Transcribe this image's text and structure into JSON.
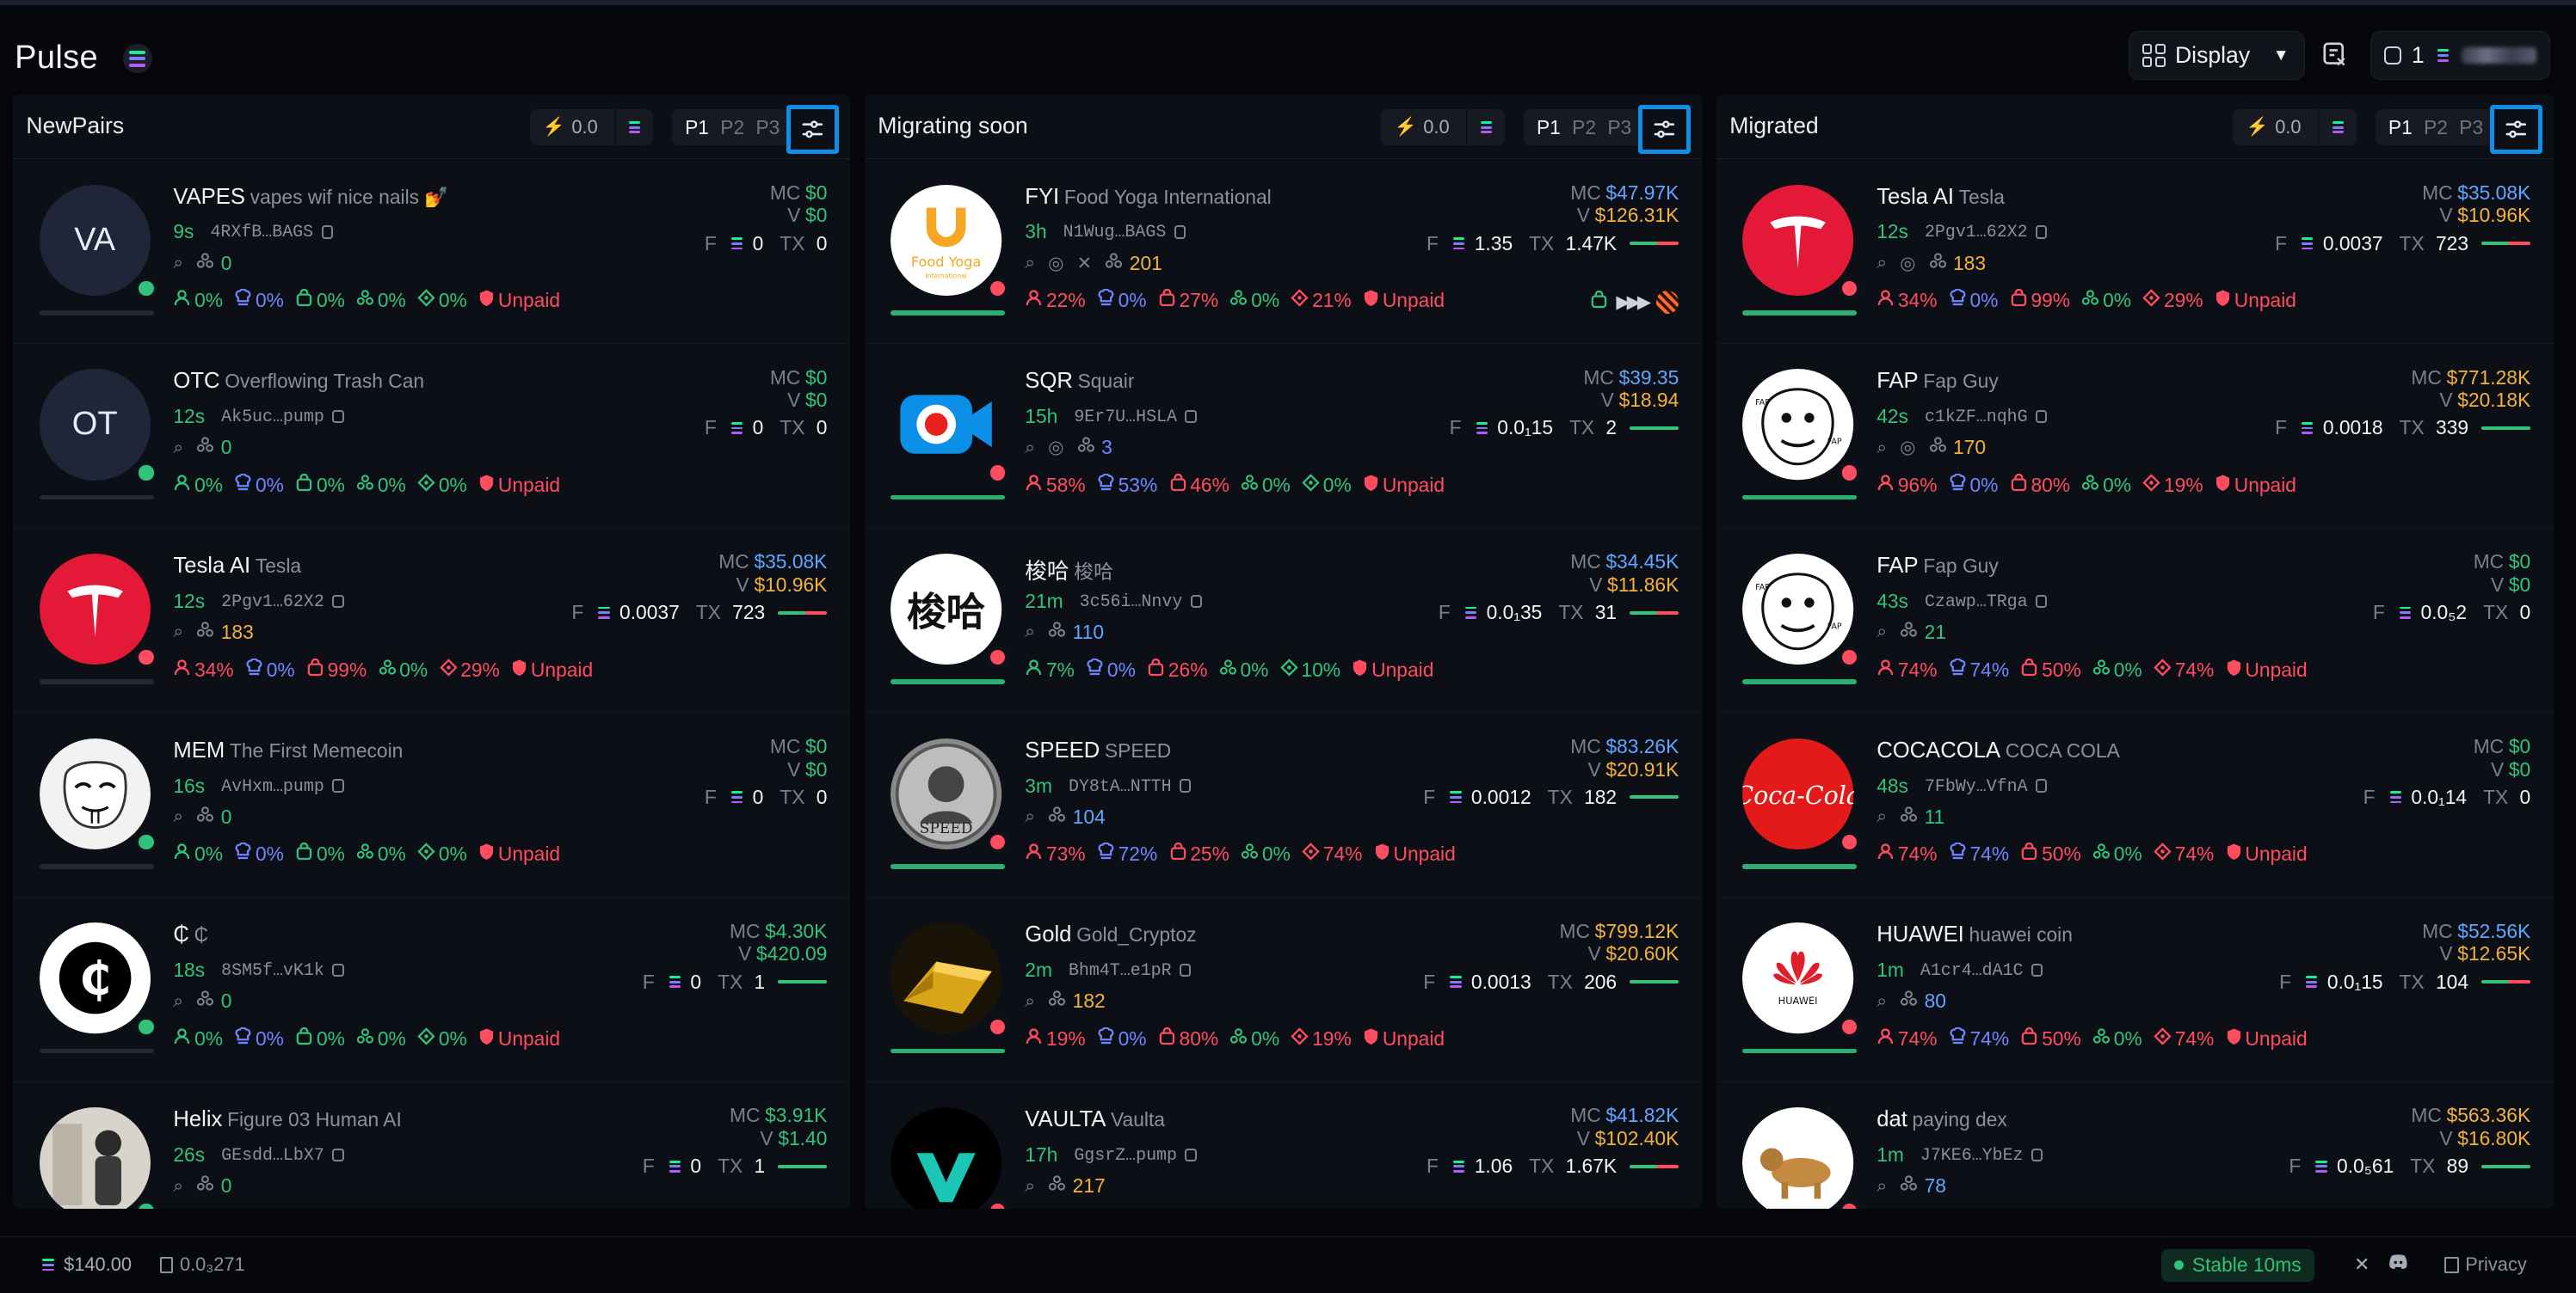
{
  "header": {
    "title": "Pulse",
    "display_label": "Display",
    "wallet_count": "1"
  },
  "columns": [
    {
      "title": "Migrating soon",
      "speed": "0.0",
      "presets": [
        "P1",
        "P2",
        "P3"
      ],
      "rows": [
        {
          "ticker": "FYI",
          "name": "Food Yoga International",
          "age": "3h",
          "addr": "N1Wug…BAGS",
          "holders": "201",
          "holders_color": "#f3b23a",
          "mc": "$47.97K",
          "mc_color": "#5fa7ff",
          "v": "$126.31K",
          "f": "1.35",
          "tx": "1.47K",
          "stats": [
            [
              "22%",
              "r"
            ],
            [
              "0%",
              "b"
            ],
            [
              "27%",
              "r"
            ],
            [
              "0%",
              "g"
            ],
            [
              "21%",
              "r"
            ]
          ],
          "paid": "Unpaid",
          "avatar": "fyi",
          "bar": "#ff4c5f",
          "progress": 1
        },
        {
          "ticker": "SQR",
          "name": "Squair",
          "age": "15h",
          "addr": "9Er7U…HSLA",
          "holders": "3",
          "holders_color": "#6f86ff",
          "mc": "$39.35",
          "mc_color": "#5fa7ff",
          "v": "$18.94",
          "f": "0.0₁15",
          "tx": "2",
          "stats": [
            [
              "58%",
              "r"
            ],
            [
              "53%",
              "b"
            ],
            [
              "46%",
              "r"
            ],
            [
              "0%",
              "g"
            ],
            [
              "0%",
              "g"
            ]
          ],
          "paid": "Unpaid",
          "avatar": "sqr",
          "bar": "#31c27c",
          "progress": 1
        },
        {
          "ticker": "梭哈",
          "name": "梭哈",
          "age": "21m",
          "addr": "3c56i…Nnvy",
          "holders": "110",
          "holders_color": "#5fa7ff",
          "mc": "$34.45K",
          "mc_color": "#5fa7ff",
          "v": "$11.86K",
          "f": "0.0₁35",
          "tx": "31",
          "stats": [
            [
              "7%",
              "g"
            ],
            [
              "0%",
              "b"
            ],
            [
              "26%",
              "r"
            ],
            [
              "0%",
              "g"
            ],
            [
              "10%",
              "g"
            ]
          ],
          "paid": "Unpaid",
          "avatar": "suoha",
          "bar": "#ff4c5f",
          "progress": 1
        },
        {
          "ticker": "SPEED",
          "name": "SPEED",
          "age": "3m",
          "addr": "DY8tA…NTTH",
          "holders": "104",
          "holders_color": "#5fa7ff",
          "mc": "$83.26K",
          "mc_color": "#5fa7ff",
          "v": "$20.91K",
          "f": "0.0012",
          "tx": "182",
          "stats": [
            [
              "73%",
              "r"
            ],
            [
              "72%",
              "b"
            ],
            [
              "25%",
              "r"
            ],
            [
              "0%",
              "g"
            ],
            [
              "74%",
              "r"
            ]
          ],
          "paid": "Unpaid",
          "avatar": "speed",
          "bar": "#31c27c",
          "progress": 1
        },
        {
          "ticker": "Gold",
          "name": "Gold_Cryptoz",
          "age": "2m",
          "addr": "Bhm4T…e1pR",
          "holders": "182",
          "holders_color": "#f3b23a",
          "mc": "$799.12K",
          "mc_color": "#f3b23a",
          "v": "$20.60K",
          "f": "0.0013",
          "tx": "206",
          "stats": [
            [
              "19%",
              "r"
            ],
            [
              "0%",
              "b"
            ],
            [
              "80%",
              "r"
            ],
            [
              "0%",
              "g"
            ],
            [
              "19%",
              "r"
            ]
          ],
          "paid": "Unpaid",
          "avatar": "gold",
          "bar": "#31c27c",
          "progress": 1
        },
        {
          "ticker": "VAULTA",
          "name": "Vaulta",
          "age": "17h",
          "addr": "GgsrZ…pump",
          "holders": "217",
          "holders_color": "#f3b23a",
          "mc": "$41.82K",
          "mc_color": "#5fa7ff",
          "v": "$102.40K",
          "f": "1.06",
          "tx": "1.67K",
          "stats": [],
          "paid": "",
          "avatar": "vaulta",
          "bar": "#ff4c5f",
          "progress": 1
        }
      ]
    },
    {
      "title": "NewPairs",
      "speed": "0.0",
      "presets": [
        "P1",
        "P2",
        "P3"
      ],
      "rows": [
        {
          "ticker": "VAPES",
          "name": "vapes wif nice nails 💅",
          "age": "9s",
          "addr": "4RXfB…BAGS",
          "holders": "0",
          "holders_color": "#31c27c",
          "mc": "$0",
          "mc_color": "#31c27c",
          "v": "$0",
          "f": "0",
          "tx": "0",
          "stats": [
            [
              "0%",
              "g"
            ],
            [
              "0%",
              "b"
            ],
            [
              "0%",
              "g"
            ],
            [
              "0%",
              "g"
            ],
            [
              "0%",
              "g"
            ]
          ],
          "paid": "Unpaid",
          "avatar": "VA",
          "bar": "",
          "progress": 0
        },
        {
          "ticker": "OTC",
          "name": "Overflowing Trash Can",
          "age": "12s",
          "addr": "Ak5uc…pump",
          "holders": "0",
          "holders_color": "#31c27c",
          "mc": "$0",
          "mc_color": "#31c27c",
          "v": "$0",
          "f": "0",
          "tx": "0",
          "stats": [
            [
              "0%",
              "g"
            ],
            [
              "0%",
              "b"
            ],
            [
              "0%",
              "g"
            ],
            [
              "0%",
              "g"
            ],
            [
              "0%",
              "g"
            ]
          ],
          "paid": "Unpaid",
          "avatar": "OT",
          "bar": "",
          "progress": 0
        },
        {
          "ticker": "Tesla AI",
          "name": "Tesla",
          "age": "12s",
          "addr": "2Pgv1…62X2",
          "holders": "183",
          "holders_color": "#f3b23a",
          "mc": "$35.08K",
          "mc_color": "#5fa7ff",
          "v": "$10.96K",
          "f": "0.0037",
          "tx": "723",
          "stats": [
            [
              "34%",
              "r"
            ],
            [
              "0%",
              "b"
            ],
            [
              "99%",
              "r"
            ],
            [
              "0%",
              "g"
            ],
            [
              "29%",
              "r"
            ]
          ],
          "paid": "Unpaid",
          "avatar": "tesla",
          "bar": "#ff4c5f",
          "progress": 0
        },
        {
          "ticker": "MEM",
          "name": "The First Memecoin",
          "age": "16s",
          "addr": "AvHxm…pump",
          "holders": "0",
          "holders_color": "#31c27c",
          "mc": "$0",
          "mc_color": "#31c27c",
          "v": "$0",
          "f": "0",
          "tx": "0",
          "stats": [
            [
              "0%",
              "g"
            ],
            [
              "0%",
              "b"
            ],
            [
              "0%",
              "g"
            ],
            [
              "0%",
              "g"
            ],
            [
              "0%",
              "g"
            ]
          ],
          "paid": "Unpaid",
          "avatar": "mask",
          "bar": "",
          "progress": 0
        },
        {
          "ticker": "₵",
          "name": "₵",
          "age": "18s",
          "addr": "8SM5f…vK1k",
          "holders": "0",
          "holders_color": "#31c27c",
          "mc": "$4.30K",
          "mc_color": "#31c27c",
          "v": "$420.09",
          "f": "0",
          "tx": "1",
          "stats": [
            [
              "0%",
              "g"
            ],
            [
              "0%",
              "b"
            ],
            [
              "0%",
              "g"
            ],
            [
              "0%",
              "g"
            ],
            [
              "0%",
              "g"
            ]
          ],
          "paid": "Unpaid",
          "avatar": "cedi",
          "bar": "#31c27c",
          "progress": 0
        },
        {
          "ticker": "Helix",
          "name": "Figure 03 Human AI",
          "age": "26s",
          "addr": "GEsdd…LbX7",
          "holders": "0",
          "holders_color": "#31c27c",
          "mc": "$3.91K",
          "mc_color": "#31c27c",
          "v": "$1.40",
          "f": "0",
          "tx": "1",
          "stats": [],
          "paid": "",
          "avatar": "helix",
          "bar": "#31c27c",
          "progress": 0
        }
      ]
    },
    {
      "title": "Migrated",
      "speed": "0.0",
      "presets": [
        "P1",
        "P2",
        "P3"
      ],
      "rows": [
        {
          "ticker": "Tesla AI",
          "name": "Tesla",
          "age": "12s",
          "addr": "2Pgv1…62X2",
          "holders": "183",
          "holders_color": "#f3b23a",
          "mc": "$35.08K",
          "mc_color": "#5fa7ff",
          "v": "$10.96K",
          "f": "0.0037",
          "tx": "723",
          "stats": [
            [
              "34%",
              "r"
            ],
            [
              "0%",
              "b"
            ],
            [
              "99%",
              "r"
            ],
            [
              "0%",
              "g"
            ],
            [
              "29%",
              "r"
            ]
          ],
          "paid": "Unpaid",
          "avatar": "tesla",
          "bar": "#ff4c5f",
          "progress": 1
        },
        {
          "ticker": "FAP",
          "name": "Fap Guy",
          "age": "42s",
          "addr": "c1kZF…nqhG",
          "holders": "170",
          "holders_color": "#f3b23a",
          "mc": "$771.28K",
          "mc_color": "#f3b23a",
          "v": "$20.18K",
          "f": "0.0018",
          "tx": "339",
          "stats": [
            [
              "96%",
              "r"
            ],
            [
              "0%",
              "b"
            ],
            [
              "80%",
              "r"
            ],
            [
              "0%",
              "g"
            ],
            [
              "19%",
              "r"
            ]
          ],
          "paid": "Unpaid",
          "avatar": "rage",
          "bar": "#31c27c",
          "progress": 1
        },
        {
          "ticker": "FAP",
          "name": "Fap Guy",
          "age": "43s",
          "addr": "Czawp…TRga",
          "holders": "21",
          "holders_color": "#31c27c",
          "mc": "$0",
          "mc_color": "#31c27c",
          "v": "$0",
          "f": "0.0₅2",
          "tx": "0",
          "stats": [
            [
              "74%",
              "r"
            ],
            [
              "74%",
              "b"
            ],
            [
              "50%",
              "r"
            ],
            [
              "0%",
              "g"
            ],
            [
              "74%",
              "r"
            ]
          ],
          "paid": "Unpaid",
          "avatar": "rage",
          "bar": "",
          "progress": 1
        },
        {
          "ticker": "COCACOLA",
          "name": "COCA COLA",
          "age": "48s",
          "addr": "7FbWy…VfnA",
          "holders": "11",
          "holders_color": "#31c27c",
          "mc": "$0",
          "mc_color": "#31c27c",
          "v": "$0",
          "f": "0.0₁14",
          "tx": "0",
          "stats": [
            [
              "74%",
              "r"
            ],
            [
              "74%",
              "b"
            ],
            [
              "50%",
              "r"
            ],
            [
              "0%",
              "g"
            ],
            [
              "74%",
              "r"
            ]
          ],
          "paid": "Unpaid",
          "avatar": "coke",
          "bar": "",
          "progress": 1
        },
        {
          "ticker": "HUAWEI",
          "name": "huawei coin",
          "age": "1m",
          "addr": "A1cr4…dA1C",
          "holders": "80",
          "holders_color": "#5fa7ff",
          "mc": "$52.56K",
          "mc_color": "#5fa7ff",
          "v": "$12.65K",
          "f": "0.0₁15",
          "tx": "104",
          "stats": [
            [
              "74%",
              "r"
            ],
            [
              "74%",
              "b"
            ],
            [
              "50%",
              "r"
            ],
            [
              "0%",
              "g"
            ],
            [
              "74%",
              "r"
            ]
          ],
          "paid": "Unpaid",
          "avatar": "huawei",
          "bar": "#ff4c5f",
          "progress": 1
        },
        {
          "ticker": "dat",
          "name": "paying dex",
          "age": "1m",
          "addr": "J7KE6…YbEz",
          "holders": "78",
          "holders_color": "#5fa7ff",
          "mc": "$563.36K",
          "mc_color": "#f3b23a",
          "v": "$16.80K",
          "f": "0.0₅61",
          "tx": "89",
          "stats": [],
          "paid": "",
          "avatar": "dog",
          "bar": "#31c27c",
          "progress": 1
        }
      ]
    }
  ],
  "footer": {
    "sol_price": "$140.00",
    "fee": "0.0₃271",
    "status": "Stable 10ms",
    "privacy": "Privacy"
  },
  "colors": {
    "accent_filter": "#0d8fe8",
    "green": "#31c27c",
    "red": "#ff4c5f",
    "blue": "#5fa7ff",
    "yellow": "#f3b23a",
    "purple": "#6f86ff"
  }
}
